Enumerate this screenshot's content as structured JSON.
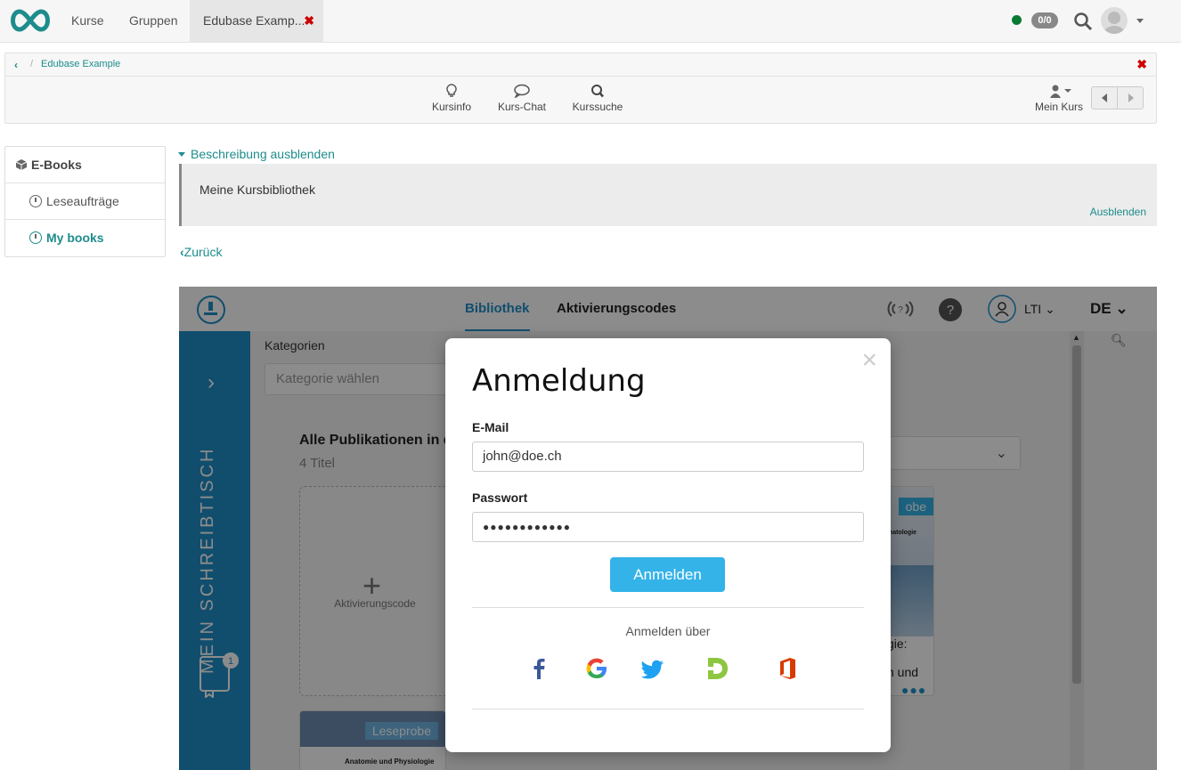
{
  "topnav": {
    "courses": "Kurse",
    "groups": "Gruppen",
    "active_tab": "Edubase Examp...",
    "notification_count": "0/0"
  },
  "course": {
    "breadcrumb_title": "Edubase Example",
    "tools": {
      "info": "Kursinfo",
      "chat": "Kurs-Chat",
      "search": "Kurssuche",
      "my_course": "Mein Kurs"
    }
  },
  "leftmenu": {
    "header": "E-Books",
    "items": [
      "Leseaufträge",
      "My books"
    ]
  },
  "description": {
    "toggle": "Beschreibung ausblenden",
    "text": "Meine Kursbibliothek",
    "hide": "Ausblenden"
  },
  "back": "Zurück",
  "app": {
    "tabs": [
      "Bibliothek",
      "Aktivierungscodes"
    ],
    "user": "LTI",
    "lang": "DE",
    "sidebar_label": "MEIN SCHREIBTISCH",
    "sidebar_badge": "1",
    "category_label": "Kategorien",
    "category_placeholder": "Kategorie wählen",
    "all_pubs": "Alle Publikationen in d",
    "count": "4 Titel",
    "activation_label": "Aktivierungscode",
    "sample_label": "Leseprobe",
    "sample_label_right": "obe",
    "book_title_bottom": "Anatomie und Physiologie",
    "book_right_text1": "matologie",
    "book_right_text2": "gie:",
    "book_right_text3": "n und"
  },
  "modal": {
    "title": "Anmeldung",
    "email_label": "E-Mail",
    "email_value": "john@doe.ch",
    "password_label": "Passwort",
    "password_value": "●●●●●●●●●●●●",
    "submit": "Anmelden",
    "via": "Anmelden über",
    "providers": [
      "facebook-icon",
      "google-icon",
      "twitter-icon",
      "d-icon",
      "office-icon"
    ]
  },
  "colors": {
    "teal": "#1e8c8c",
    "blue": "#1f8fc9",
    "button": "#33b3e8"
  }
}
